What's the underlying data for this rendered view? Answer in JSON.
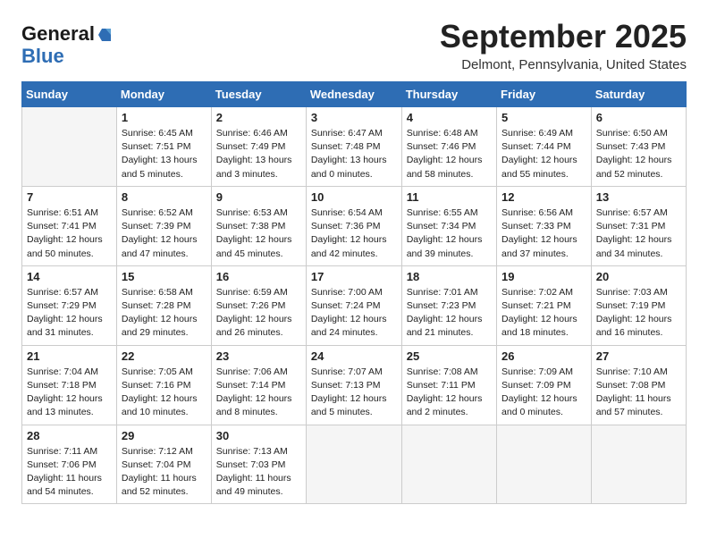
{
  "logo": {
    "line1": "General",
    "icon": "▶",
    "line2": "Blue"
  },
  "title": "September 2025",
  "subtitle": "Delmont, Pennsylvania, United States",
  "days_of_week": [
    "Sunday",
    "Monday",
    "Tuesday",
    "Wednesday",
    "Thursday",
    "Friday",
    "Saturday"
  ],
  "weeks": [
    [
      {
        "day": "",
        "info": ""
      },
      {
        "day": "1",
        "info": "Sunrise: 6:45 AM\nSunset: 7:51 PM\nDaylight: 13 hours\nand 5 minutes."
      },
      {
        "day": "2",
        "info": "Sunrise: 6:46 AM\nSunset: 7:49 PM\nDaylight: 13 hours\nand 3 minutes."
      },
      {
        "day": "3",
        "info": "Sunrise: 6:47 AM\nSunset: 7:48 PM\nDaylight: 13 hours\nand 0 minutes."
      },
      {
        "day": "4",
        "info": "Sunrise: 6:48 AM\nSunset: 7:46 PM\nDaylight: 12 hours\nand 58 minutes."
      },
      {
        "day": "5",
        "info": "Sunrise: 6:49 AM\nSunset: 7:44 PM\nDaylight: 12 hours\nand 55 minutes."
      },
      {
        "day": "6",
        "info": "Sunrise: 6:50 AM\nSunset: 7:43 PM\nDaylight: 12 hours\nand 52 minutes."
      }
    ],
    [
      {
        "day": "7",
        "info": "Sunrise: 6:51 AM\nSunset: 7:41 PM\nDaylight: 12 hours\nand 50 minutes."
      },
      {
        "day": "8",
        "info": "Sunrise: 6:52 AM\nSunset: 7:39 PM\nDaylight: 12 hours\nand 47 minutes."
      },
      {
        "day": "9",
        "info": "Sunrise: 6:53 AM\nSunset: 7:38 PM\nDaylight: 12 hours\nand 45 minutes."
      },
      {
        "day": "10",
        "info": "Sunrise: 6:54 AM\nSunset: 7:36 PM\nDaylight: 12 hours\nand 42 minutes."
      },
      {
        "day": "11",
        "info": "Sunrise: 6:55 AM\nSunset: 7:34 PM\nDaylight: 12 hours\nand 39 minutes."
      },
      {
        "day": "12",
        "info": "Sunrise: 6:56 AM\nSunset: 7:33 PM\nDaylight: 12 hours\nand 37 minutes."
      },
      {
        "day": "13",
        "info": "Sunrise: 6:57 AM\nSunset: 7:31 PM\nDaylight: 12 hours\nand 34 minutes."
      }
    ],
    [
      {
        "day": "14",
        "info": "Sunrise: 6:57 AM\nSunset: 7:29 PM\nDaylight: 12 hours\nand 31 minutes."
      },
      {
        "day": "15",
        "info": "Sunrise: 6:58 AM\nSunset: 7:28 PM\nDaylight: 12 hours\nand 29 minutes."
      },
      {
        "day": "16",
        "info": "Sunrise: 6:59 AM\nSunset: 7:26 PM\nDaylight: 12 hours\nand 26 minutes."
      },
      {
        "day": "17",
        "info": "Sunrise: 7:00 AM\nSunset: 7:24 PM\nDaylight: 12 hours\nand 24 minutes."
      },
      {
        "day": "18",
        "info": "Sunrise: 7:01 AM\nSunset: 7:23 PM\nDaylight: 12 hours\nand 21 minutes."
      },
      {
        "day": "19",
        "info": "Sunrise: 7:02 AM\nSunset: 7:21 PM\nDaylight: 12 hours\nand 18 minutes."
      },
      {
        "day": "20",
        "info": "Sunrise: 7:03 AM\nSunset: 7:19 PM\nDaylight: 12 hours\nand 16 minutes."
      }
    ],
    [
      {
        "day": "21",
        "info": "Sunrise: 7:04 AM\nSunset: 7:18 PM\nDaylight: 12 hours\nand 13 minutes."
      },
      {
        "day": "22",
        "info": "Sunrise: 7:05 AM\nSunset: 7:16 PM\nDaylight: 12 hours\nand 10 minutes."
      },
      {
        "day": "23",
        "info": "Sunrise: 7:06 AM\nSunset: 7:14 PM\nDaylight: 12 hours\nand 8 minutes."
      },
      {
        "day": "24",
        "info": "Sunrise: 7:07 AM\nSunset: 7:13 PM\nDaylight: 12 hours\nand 5 minutes."
      },
      {
        "day": "25",
        "info": "Sunrise: 7:08 AM\nSunset: 7:11 PM\nDaylight: 12 hours\nand 2 minutes."
      },
      {
        "day": "26",
        "info": "Sunrise: 7:09 AM\nSunset: 7:09 PM\nDaylight: 12 hours\nand 0 minutes."
      },
      {
        "day": "27",
        "info": "Sunrise: 7:10 AM\nSunset: 7:08 PM\nDaylight: 11 hours\nand 57 minutes."
      }
    ],
    [
      {
        "day": "28",
        "info": "Sunrise: 7:11 AM\nSunset: 7:06 PM\nDaylight: 11 hours\nand 54 minutes."
      },
      {
        "day": "29",
        "info": "Sunrise: 7:12 AM\nSunset: 7:04 PM\nDaylight: 11 hours\nand 52 minutes."
      },
      {
        "day": "30",
        "info": "Sunrise: 7:13 AM\nSunset: 7:03 PM\nDaylight: 11 hours\nand 49 minutes."
      },
      {
        "day": "",
        "info": ""
      },
      {
        "day": "",
        "info": ""
      },
      {
        "day": "",
        "info": ""
      },
      {
        "day": "",
        "info": ""
      }
    ]
  ]
}
